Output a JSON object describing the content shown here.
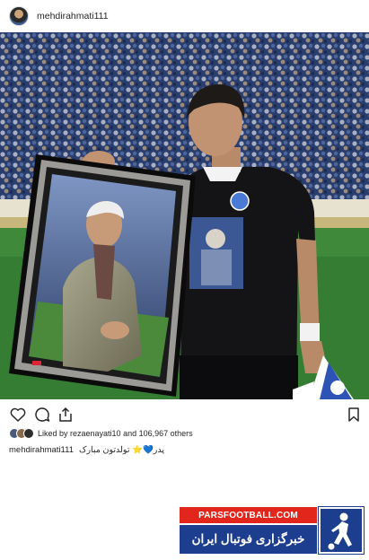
{
  "header": {
    "username": "mehdirahmati111"
  },
  "actions": {
    "like_icon": "heart-icon",
    "comment_icon": "comment-icon",
    "share_icon": "share-icon",
    "save_icon": "bookmark-icon"
  },
  "likes": {
    "text": "Liked by rezaenayati10 and 106,967 others"
  },
  "caption": {
    "username": "mehdirahmati111",
    "text": "پدر💙⭐ تولدتون مبارک"
  },
  "watermark": {
    "site": "PARSFOOTBALL.COM",
    "tagline": "خبرگزاری فوتبال ایران"
  },
  "colors": {
    "watermark_red": "#e2261c",
    "watermark_blue": "#1d3e8e",
    "jersey_black": "#141416",
    "pitch_green": "#3e8a3a"
  }
}
